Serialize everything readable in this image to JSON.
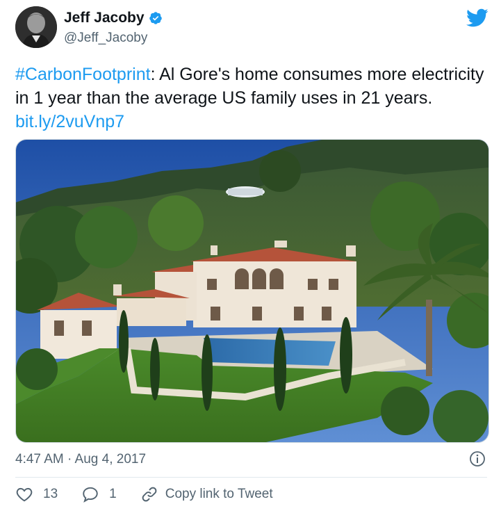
{
  "author": {
    "name": "Jeff Jacoby",
    "handle": "@Jeff_Jacoby",
    "verified": true
  },
  "tweet": {
    "hashtag": "#CarbonFootprint",
    "text": ": Al Gore's home consumes more electricity in 1 year than the average US family uses in 21 years. ",
    "link": "bit.ly/2vuVnp7",
    "timestamp": "4:47 AM · Aug 4, 2017"
  },
  "actions": {
    "likes": "13",
    "replies": "1",
    "copy_link_label": "Copy link to Tweet"
  },
  "colors": {
    "accent": "#1d9bf0",
    "muted": "#536471",
    "like_icon": "#536471"
  },
  "icons": [
    "verified-badge-icon",
    "twitter-bird-icon",
    "info-icon",
    "heart-icon",
    "reply-icon",
    "link-icon"
  ]
}
